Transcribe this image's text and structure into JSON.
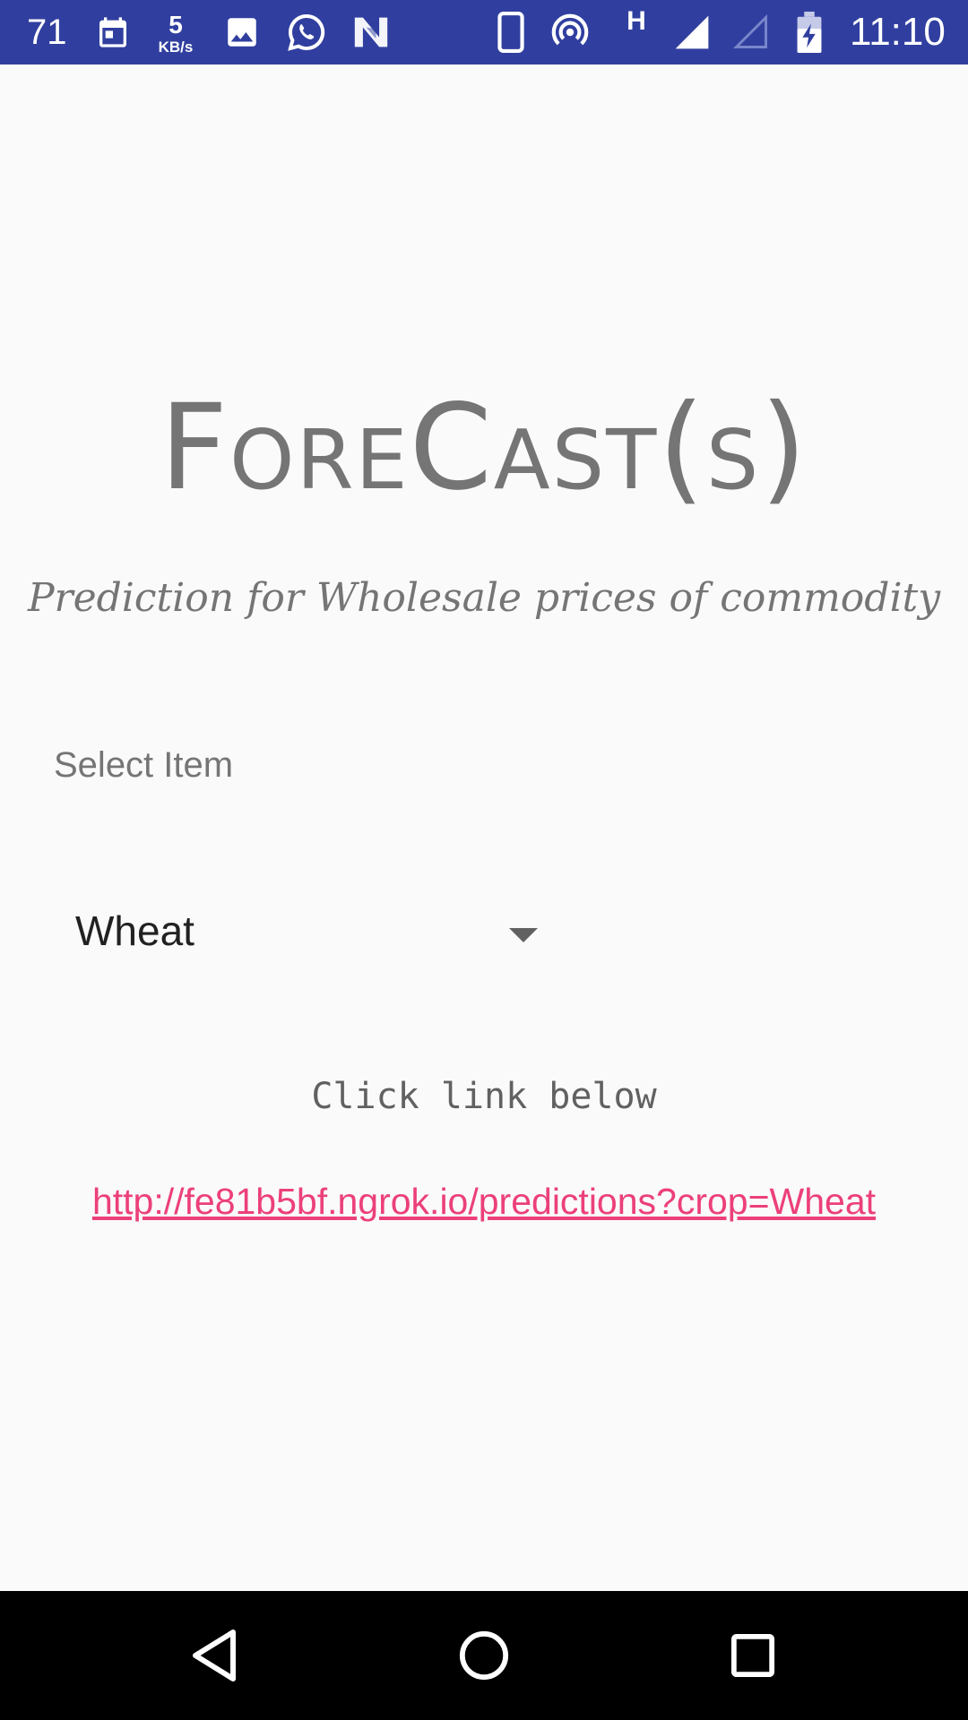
{
  "status_bar": {
    "temperature": "71",
    "net_speed_value": "5",
    "net_speed_unit": "KB/s",
    "network_type": "H",
    "time": "11:10",
    "icons": [
      "calendar-icon",
      "gallery-icon",
      "whatsapp-icon",
      "n-app-icon",
      "phone-icon",
      "hotspot-icon",
      "signal-icon",
      "signal-empty-icon",
      "battery-charging-icon"
    ],
    "background_color": "#303f9f"
  },
  "main": {
    "title": "ForeCast(s)",
    "subtitle": "Prediction for Wholesale prices of commodity",
    "select_label": "Select Item",
    "spinner": {
      "selected_value": "Wheat"
    },
    "hint": "Click link below",
    "link": "http://fe81b5bf.ngrok.io/predictions?crop=Wheat",
    "link_color": "#ec407a"
  },
  "nav_bar": {
    "buttons": [
      "back-icon",
      "home-icon",
      "recents-icon"
    ]
  }
}
